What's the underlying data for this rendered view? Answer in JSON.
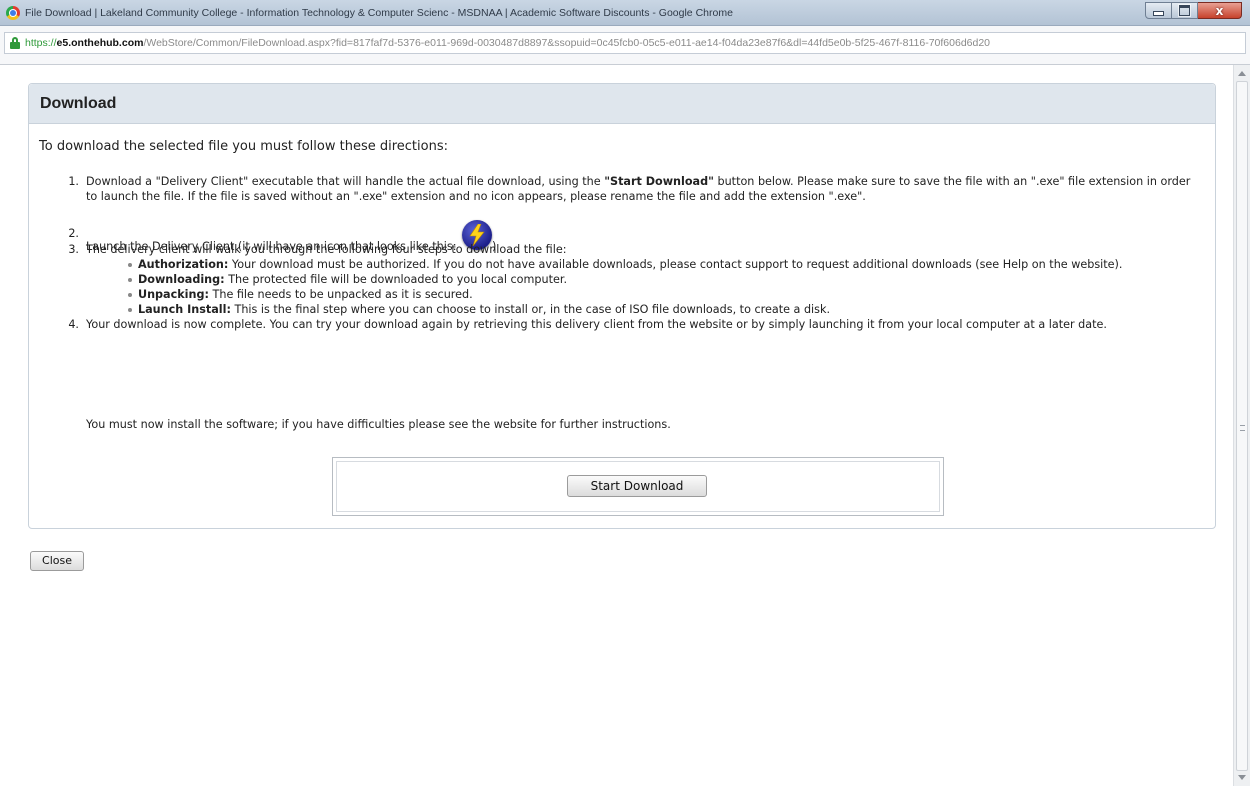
{
  "window": {
    "title": "File Download | Lakeland Community College - Information Technology & Computer Scienc - MSDNAA | Academic Software Discounts - Google Chrome"
  },
  "address_bar": {
    "scheme": "https://",
    "host": "e5.onthehub.com",
    "path": "/WebStore/Common/FileDownload.aspx?fid=817faf7d-5376-e011-969d-0030487d8897&ssopuid=0c45fcb0-05c5-e011-ae14-f04da23e87f6&dl=44fd5e0b-5f25-467f-8116-70f606d6d20"
  },
  "panel": {
    "title": "Download",
    "intro": "To download the selected file you must follow these directions:"
  },
  "steps": {
    "s1_num": "1.",
    "s1_a": "Download a \"Delivery Client\" executable that will handle the actual file download, using the ",
    "s1_bold": "\"Start Download\"",
    "s1_b": " button below. Please make sure to save the file with an \".exe\" file extension in order to launch the file. If the file is saved without an \".exe\" extension and no icon appears, please rename the file and add the extension \".exe\".",
    "s2_num": "2.",
    "s2_text": "Launch the Delivery Client (it will have an icon that looks like this:",
    "s2_close": ")",
    "s3_num": "3.",
    "s3_text": "The delivery client will walk you through the following four steps to download the file:",
    "sub": [
      {
        "label": "Authorization:",
        "text": " Your download must be authorized. If you do not have available downloads, please contact support to request additional downloads (see Help on the website)."
      },
      {
        "label": "Downloading:",
        "text": " The protected file will be downloaded to you local computer."
      },
      {
        "label": "Unpacking:",
        "text": " The file needs to be unpacked as it is secured."
      },
      {
        "label": "Launch Install:",
        "text": " This is the final step where you can choose to install or, in the case of ISO file downloads, to create a disk."
      }
    ],
    "s4_num": "4.",
    "s4_text": "Your download is now complete. You can try your download again by retrieving this delivery client from the website or by simply launching it from your local computer at a later date.",
    "note": "You must now install the software; if you have difficulties please see the website for further instructions."
  },
  "buttons": {
    "start_download": "Start Download",
    "close": "Close",
    "window_close_glyph": "x"
  },
  "icons": {
    "app": "chrome-icon",
    "lock": "lock-icon",
    "bolt": "delivery-client-bolt-icon"
  },
  "colors": {
    "header_bg": "#dfe6ed",
    "secure_green": "#2f9a3a",
    "bolt_blue": "#1d1f8a"
  }
}
